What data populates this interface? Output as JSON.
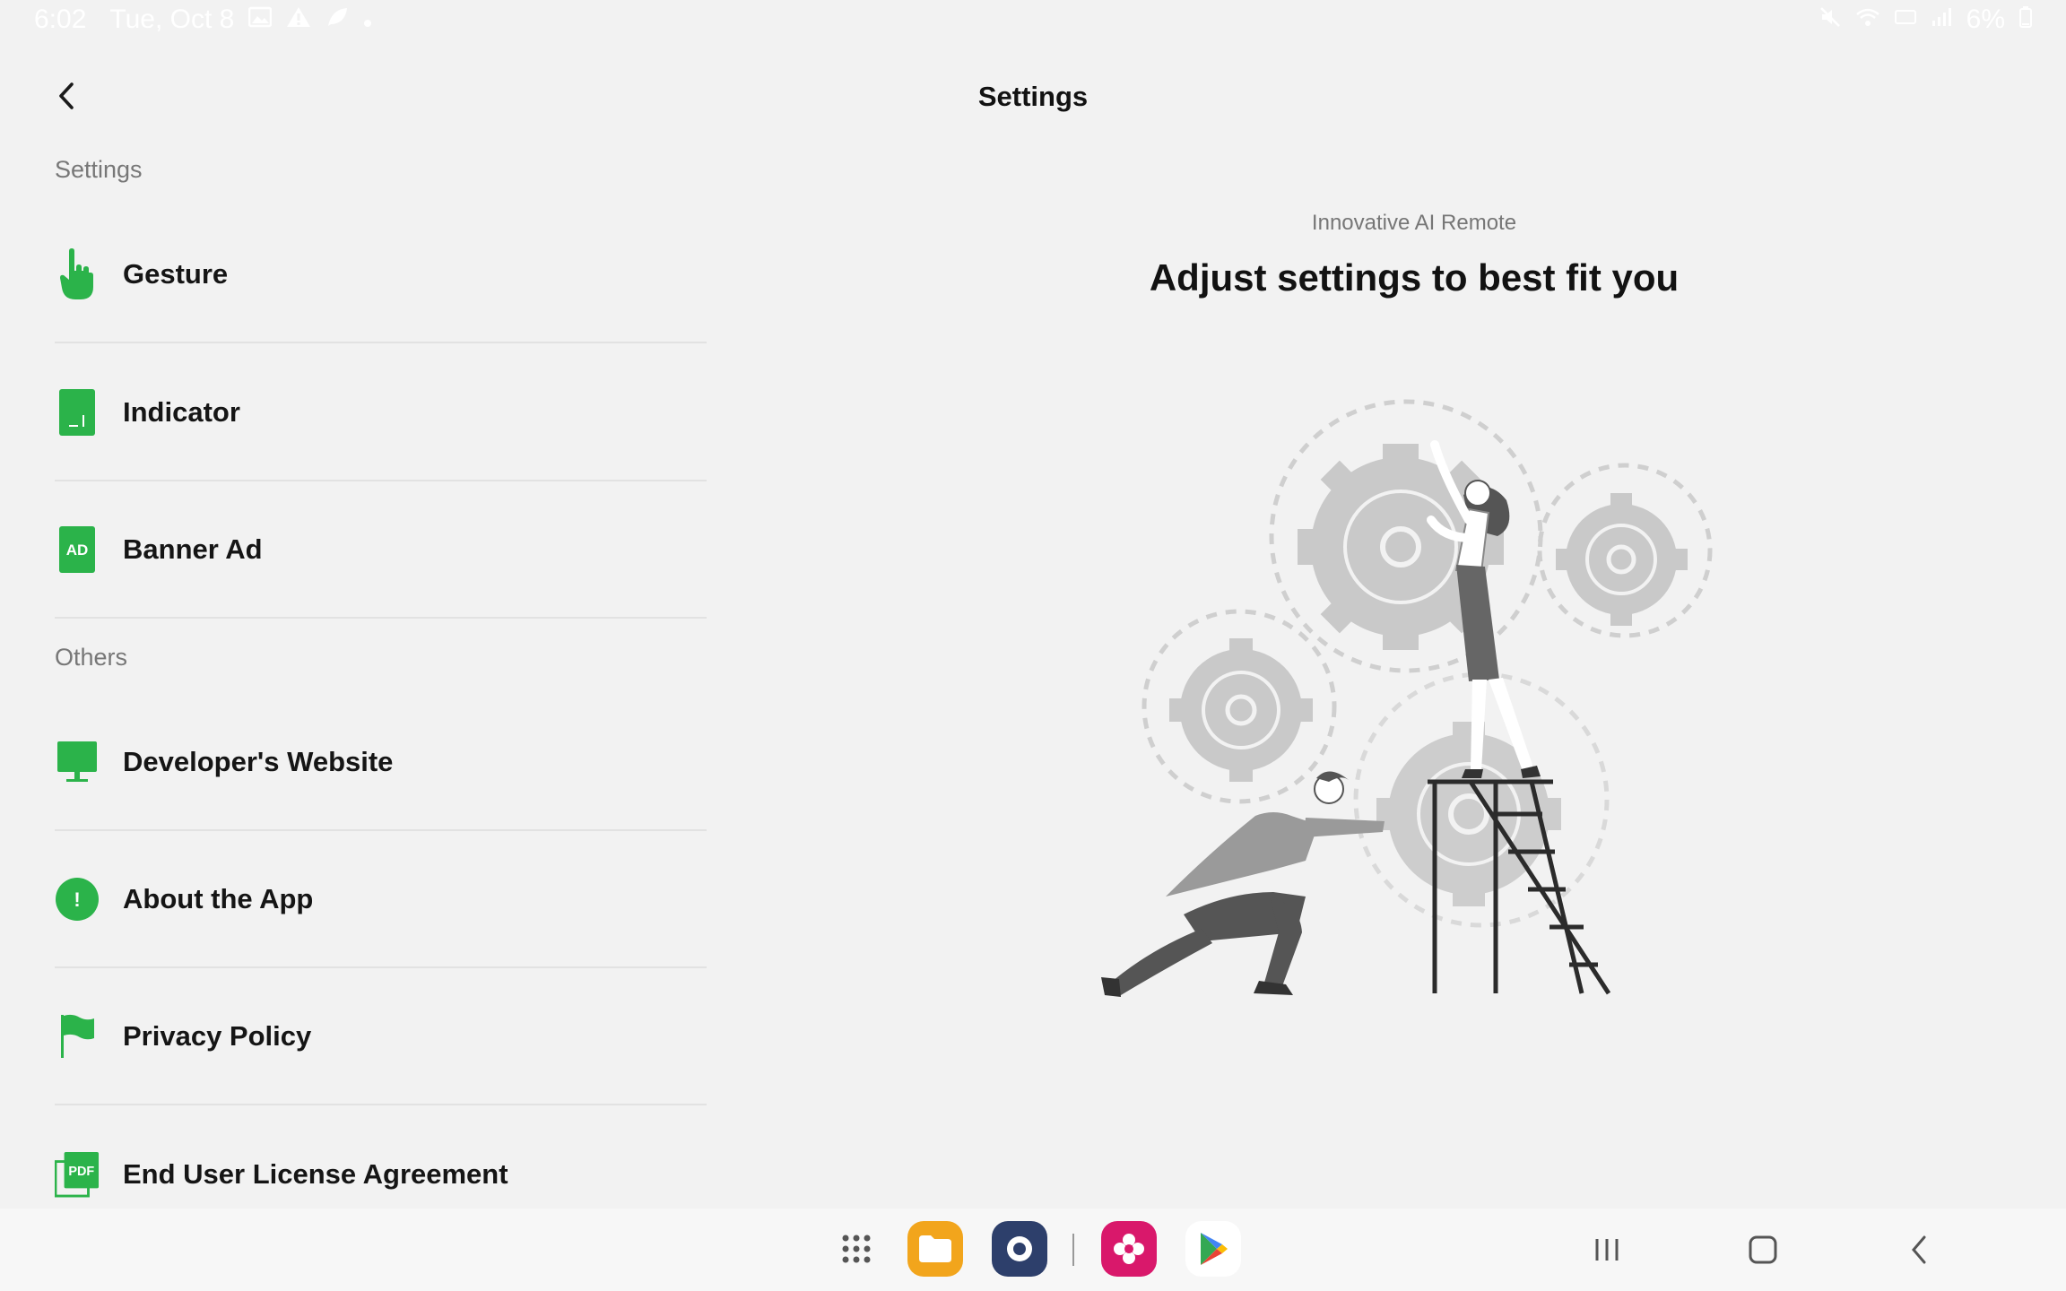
{
  "status_bar": {
    "time": "6:02",
    "date": "Tue, Oct 8",
    "battery": "6%",
    "left_icons": [
      "gallery-icon",
      "alert-icon",
      "leaf-icon",
      "dot-icon"
    ],
    "right_icons": [
      "mute-icon",
      "wifi-icon",
      "hd-icon",
      "signal-icon",
      "battery-icon"
    ]
  },
  "header": {
    "title": "Settings",
    "back_icon": "chevron-left-icon"
  },
  "sidebar": {
    "sections": [
      {
        "title": "Settings",
        "items": [
          {
            "label": "Gesture",
            "icon": "hand-pointer-icon"
          },
          {
            "label": "Indicator",
            "icon": "indicator-icon"
          },
          {
            "label": "Banner Ad",
            "icon": "ad-icon"
          }
        ]
      },
      {
        "title": "Others",
        "items": [
          {
            "label": "Developer's Website",
            "icon": "monitor-icon"
          },
          {
            "label": "About the App",
            "icon": "info-icon"
          },
          {
            "label": "Privacy Policy",
            "icon": "flag-icon"
          },
          {
            "label": "End User License Agreement",
            "icon": "pdf-icon"
          }
        ]
      }
    ]
  },
  "main": {
    "subtitle": "Innovative AI Remote",
    "headline": "Adjust settings to best fit you",
    "ad_icon_text": "AD",
    "pdf_icon_text": "PDF",
    "info_icon_text": "!"
  },
  "colors": {
    "accent_green": "#2bb34a",
    "background": "#f2f2f2",
    "divider": "#e2e2e2"
  },
  "nav_bar": {
    "apps": [
      "apps-grid-icon",
      "files-app-icon",
      "settings-app-icon",
      "gallery-app-icon",
      "play-store-icon"
    ],
    "buttons": [
      "recents-icon",
      "home-icon",
      "back-icon"
    ]
  }
}
